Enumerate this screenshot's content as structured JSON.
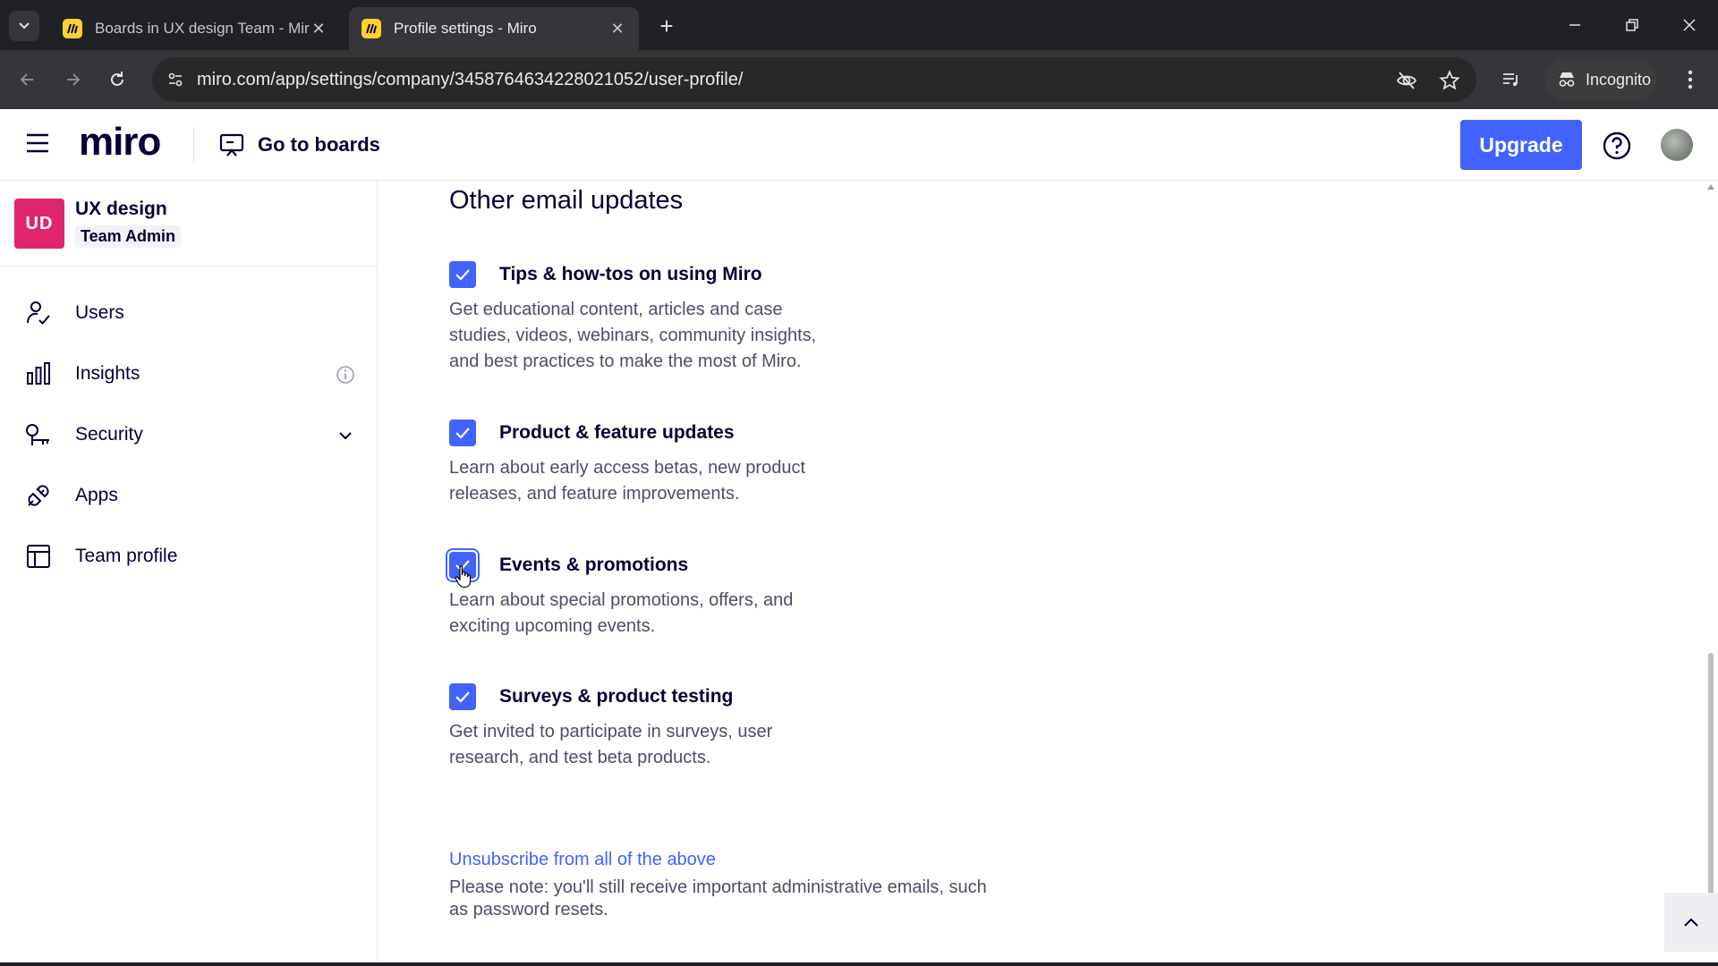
{
  "browser": {
    "tabs": [
      {
        "title": "Boards in UX design Team - Miro",
        "active": false
      },
      {
        "title": "Profile settings - Miro",
        "active": true
      }
    ],
    "url": "miro.com/app/settings/company/3458764634228021052/user-profile/",
    "incognito_label": "Incognito"
  },
  "header": {
    "logo": "miro",
    "go_to_boards": "Go to boards",
    "upgrade_label": "Upgrade"
  },
  "sidebar": {
    "team": {
      "initials": "UD",
      "name": "UX design",
      "role": "Team Admin",
      "badge_color": "#e0256f"
    },
    "items": [
      {
        "label": "Users",
        "icon": "user-check-icon"
      },
      {
        "label": "Insights",
        "icon": "bar-chart-icon",
        "extra": "info-icon"
      },
      {
        "label": "Security",
        "icon": "key-icon",
        "extra": "chevron-down-icon"
      },
      {
        "label": "Apps",
        "icon": "plug-icon"
      },
      {
        "label": "Team profile",
        "icon": "layout-icon"
      }
    ]
  },
  "main": {
    "section_title": "Other email updates",
    "options": [
      {
        "title": "Tips & how-tos on using Miro",
        "description": "Get educational content, articles and case studies, videos, webinars, community insights, and best practices to make the most of Miro.",
        "checked": true
      },
      {
        "title": "Product & feature updates",
        "description": "Learn about early access betas, new product releases, and feature improvements.",
        "checked": true
      },
      {
        "title": "Events & promotions",
        "description": "Learn about special promotions, offers, and exciting upcoming events.",
        "checked": true
      },
      {
        "title": "Surveys & product testing",
        "description": "Get invited to participate in surveys, user research, and test beta products.",
        "checked": true
      }
    ],
    "unsubscribe_link": "Unsubscribe from all of the above",
    "unsubscribe_note": "Please note: you'll still receive important administrative emails, such as password resets."
  },
  "colors": {
    "accent": "#4262ff",
    "text": "#050038",
    "muted": "#4b4f66"
  }
}
